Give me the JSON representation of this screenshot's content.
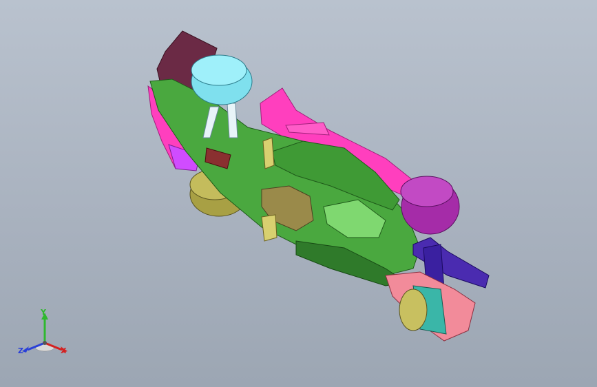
{
  "viewport": {
    "background_top": "#b9c2ce",
    "background_bottom": "#9ca6b3"
  },
  "model": {
    "description_icon": "car-3d-model",
    "part_colors": {
      "body_green": "#4aa83f",
      "nose_cone": "#7fe0ee",
      "rear_tire": "#a52ca8",
      "front_tire": "#a8a044",
      "wing_pink": "#ff3fbe",
      "rear_wing_blue": "#4a2bb0",
      "maroon_front": "#6b2a45",
      "salmon": "#f28b9a",
      "teal": "#3ab6a8"
    }
  },
  "triad": {
    "x_label": "X",
    "y_label": "Y",
    "z_label": "Z",
    "x_color": "#d42020",
    "y_color": "#2fb82f",
    "z_color": "#2a40d8"
  }
}
